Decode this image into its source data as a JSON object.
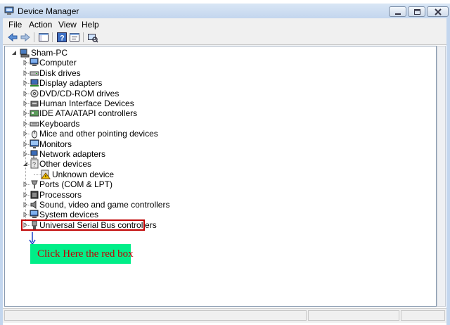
{
  "window": {
    "title": "Device Manager"
  },
  "menubar": {
    "items": [
      "File",
      "Action",
      "View",
      "Help"
    ]
  },
  "tree": {
    "root": "Sham-PC",
    "categories": [
      {
        "label": "Computer",
        "icon": "computer-icon"
      },
      {
        "label": "Disk drives",
        "icon": "disk-drive-icon"
      },
      {
        "label": "Display adapters",
        "icon": "display-adapter-icon"
      },
      {
        "label": "DVD/CD-ROM drives",
        "icon": "dvd-drive-icon"
      },
      {
        "label": "Human Interface Devices",
        "icon": "hid-icon"
      },
      {
        "label": "IDE ATA/ATAPI controllers",
        "icon": "ide-controller-icon"
      },
      {
        "label": "Keyboards",
        "icon": "keyboard-icon"
      },
      {
        "label": "Mice and other pointing devices",
        "icon": "mouse-icon"
      },
      {
        "label": "Monitors",
        "icon": "monitor-icon"
      },
      {
        "label": "Network adapters",
        "icon": "network-adapter-icon"
      },
      {
        "label": "Other devices",
        "icon": "other-devices-icon",
        "expanded": true
      },
      {
        "label": "Ports (COM & LPT)",
        "icon": "port-icon"
      },
      {
        "label": "Processors",
        "icon": "processor-icon"
      },
      {
        "label": "Sound, video and game controllers",
        "icon": "sound-icon"
      },
      {
        "label": "System devices",
        "icon": "system-devices-icon"
      },
      {
        "label": "Universal Serial Bus controllers",
        "icon": "usb-icon"
      }
    ],
    "unknown_device": "Unknown device"
  },
  "annotation": {
    "callout_text": "Click Here the red box",
    "box_color": "#c00000",
    "callout_bg": "#00ee88"
  },
  "colors": {
    "titlebar": "#c3d6ee",
    "panel_border": "#8a9bb0"
  }
}
